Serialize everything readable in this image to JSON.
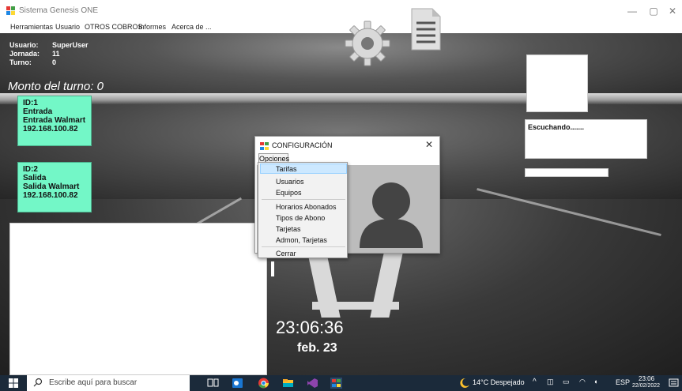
{
  "window": {
    "title": "Sistema Genesis ONE",
    "minimize_glyph": "—",
    "maximize_glyph": "▢",
    "close_glyph": "✕"
  },
  "menubar": {
    "items": [
      "Herramientas",
      "Usuario",
      "OTROS COBROS",
      "Informes",
      "Acerca de ..."
    ]
  },
  "session": {
    "usuario_label": "Usuario:",
    "usuario_value": "SuperUser",
    "jornada_label": "Jornada:",
    "jornada_value": "11",
    "turno_label": "Turno:",
    "turno_value": "0",
    "monto": "Monto del turno: 0"
  },
  "devices": [
    {
      "id": "ID:1",
      "type": "Entrada",
      "name": "Entrada Walmart",
      "ip": "192.168.100.82"
    },
    {
      "id": "ID:2",
      "type": "Salida",
      "name": "Salida Walmart",
      "ip": "192.168.100.82"
    }
  ],
  "listener": {
    "status": "Escuchando......."
  },
  "clock": {
    "time": "23:06:36",
    "date": "feb. 23"
  },
  "dialog": {
    "title": "CONFIGURACIÓN",
    "close_glyph": "✕",
    "menu_button": "Opciones",
    "menu_items": [
      "Tarifas",
      "Usuarios",
      "Equipos",
      "Horarios Abonados",
      "Tipos de Abono",
      "Tarjetas",
      "Admon, Tarjetas",
      "Cerrar"
    ],
    "highlighted_item": "Tarifas"
  },
  "taskbar": {
    "search_placeholder": "Escribe aquí para buscar",
    "weather": "14°C  Despejado",
    "language": "ESP",
    "time": "23:06",
    "date": "22/02/2022"
  },
  "colors": {
    "device_bg": "#73f7c7",
    "taskbar_bg": "#1b2a3a",
    "highlight": "#cce8ff"
  }
}
